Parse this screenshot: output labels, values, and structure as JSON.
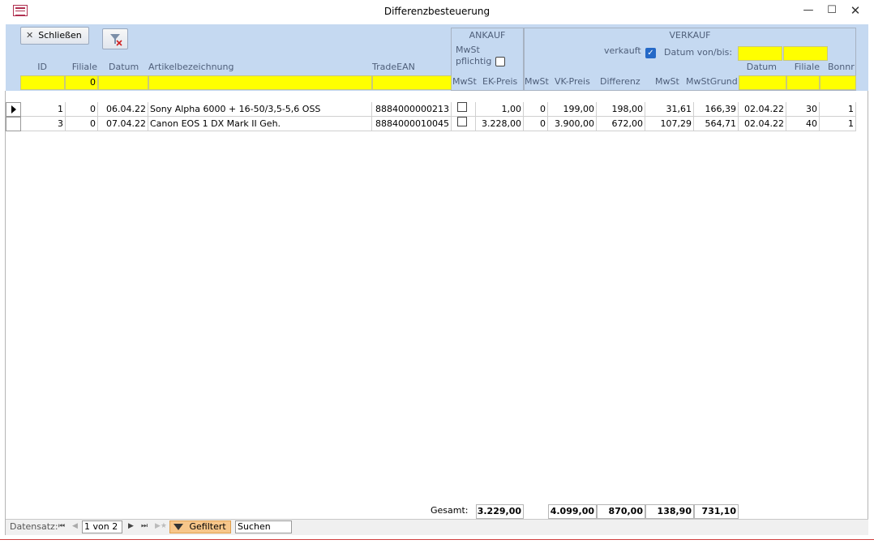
{
  "window": {
    "title": "Differenzbesteuerung"
  },
  "toolbar": {
    "close_label": "Schließen"
  },
  "header": {
    "group_ankauf": "ANKAUF",
    "group_verkauf": "VERKAUF",
    "mwst_pflichtig_line1": "MwSt",
    "mwst_pflichtig_line2": "pflichtig",
    "verkauft_label": "verkauft",
    "datum_von_bis_label": "Datum von/bis:",
    "columns": {
      "id": "ID",
      "filiale": "Filiale",
      "datum": "Datum",
      "artikel": "Artikelbezeichnung",
      "ean": "TradeEAN",
      "mwst_ank": "MwSt",
      "ek_preis": "EK-Preis",
      "mwst_vk": "MwSt",
      "vk_preis": "VK-Preis",
      "differenz": "Differenz",
      "mwst_betrag": "MwSt",
      "mwst_grund": "MwStGrund",
      "vk_datum": "Datum",
      "vk_filiale": "Filiale",
      "bonnr": "Bonnr"
    },
    "filter_filiale_value": "0",
    "verkauft_checked": true
  },
  "rows": [
    {
      "id": "1",
      "filiale": "0",
      "datum": "06.04.22",
      "artikel": "Sony Alpha 6000 + 16-50/3,5-5,6 OSS",
      "ean": "8884000000213",
      "mwst_flag": false,
      "ek_preis": "1,00",
      "mwst_vk": "0",
      "vk_preis": "199,00",
      "differenz": "198,00",
      "mwst_betrag": "31,61",
      "mwst_grund": "166,39",
      "vk_datum": "02.04.22",
      "vk_filiale": "30",
      "bonnr": "1"
    },
    {
      "id": "3",
      "filiale": "0",
      "datum": "07.04.22",
      "artikel": "Canon EOS 1 DX Mark II Geh.",
      "ean": "8884000010045",
      "mwst_flag": false,
      "ek_preis": "3.228,00",
      "mwst_vk": "0",
      "vk_preis": "3.900,00",
      "differenz": "672,00",
      "mwst_betrag": "107,29",
      "mwst_grund": "564,71",
      "vk_datum": "02.04.22",
      "vk_filiale": "40",
      "bonnr": "1"
    }
  ],
  "totals": {
    "label": "Gesamt:",
    "ek_preis": "3.229,00",
    "vk_preis": "4.099,00",
    "differenz": "870,00",
    "mwst_betrag": "138,90",
    "mwst_grund": "731,10"
  },
  "navigation": {
    "record_label": "Datensatz:",
    "record_value": "1 von 2",
    "filter_label": "Gefiltert",
    "search_placeholder": "Suchen"
  }
}
